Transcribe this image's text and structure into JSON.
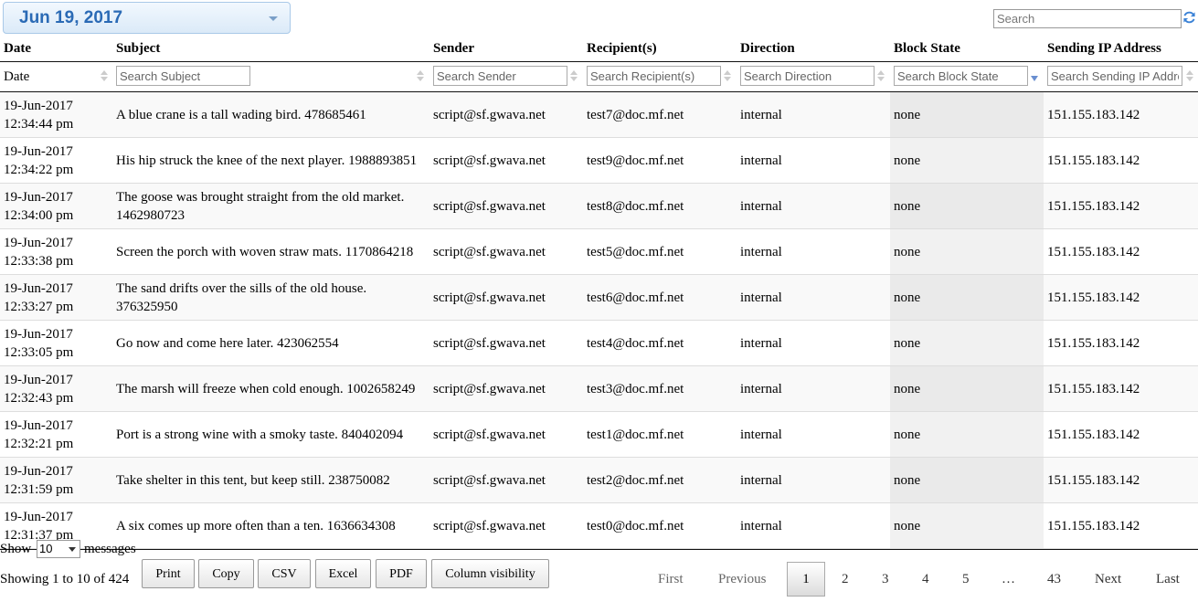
{
  "header": {
    "date_label": "Jun 19, 2017",
    "search_placeholder": "Search"
  },
  "table": {
    "columns": [
      "Date",
      "Subject",
      "Sender",
      "Recipient(s)",
      "Direction",
      "Block State",
      "Sending IP Address"
    ],
    "date_filter_label": "Date",
    "filter_placeholders": {
      "subject": "Search Subject",
      "sender": "Search Sender",
      "recipients": "Search Recipient(s)",
      "direction": "Search Direction",
      "block_state": "Search Block State",
      "ip": "Search Sending IP Address"
    },
    "rows": [
      {
        "date": "19-Jun-2017",
        "time": "12:34:44 pm",
        "subject": "A blue crane is a tall wading bird. 478685461",
        "sender": "script@sf.gwava.net",
        "recipient": "test7@doc.mf.net",
        "direction": "internal",
        "block_state": "none",
        "ip": "151.155.183.142"
      },
      {
        "date": "19-Jun-2017",
        "time": "12:34:22 pm",
        "subject": "His hip struck the knee of the next player. 1988893851",
        "sender": "script@sf.gwava.net",
        "recipient": "test9@doc.mf.net",
        "direction": "internal",
        "block_state": "none",
        "ip": "151.155.183.142"
      },
      {
        "date": "19-Jun-2017",
        "time": "12:34:00 pm",
        "subject": "The goose was brought straight from the old market. 1462980723",
        "sender": "script@sf.gwava.net",
        "recipient": "test8@doc.mf.net",
        "direction": "internal",
        "block_state": "none",
        "ip": "151.155.183.142"
      },
      {
        "date": "19-Jun-2017",
        "time": "12:33:38 pm",
        "subject": "Screen the porch with woven straw mats. 1170864218",
        "sender": "script@sf.gwava.net",
        "recipient": "test5@doc.mf.net",
        "direction": "internal",
        "block_state": "none",
        "ip": "151.155.183.142"
      },
      {
        "date": "19-Jun-2017",
        "time": "12:33:27 pm",
        "subject": "The sand drifts over the sills of the old house. 376325950",
        "sender": "script@sf.gwava.net",
        "recipient": "test6@doc.mf.net",
        "direction": "internal",
        "block_state": "none",
        "ip": "151.155.183.142"
      },
      {
        "date": "19-Jun-2017",
        "time": "12:33:05 pm",
        "subject": "Go now and come here later. 423062554",
        "sender": "script@sf.gwava.net",
        "recipient": "test4@doc.mf.net",
        "direction": "internal",
        "block_state": "none",
        "ip": "151.155.183.142"
      },
      {
        "date": "19-Jun-2017",
        "time": "12:32:43 pm",
        "subject": "The marsh will freeze when cold enough. 1002658249",
        "sender": "script@sf.gwava.net",
        "recipient": "test3@doc.mf.net",
        "direction": "internal",
        "block_state": "none",
        "ip": "151.155.183.142"
      },
      {
        "date": "19-Jun-2017",
        "time": "12:32:21 pm",
        "subject": "Port is a strong wine with a smoky taste. 840402094",
        "sender": "script@sf.gwava.net",
        "recipient": "test1@doc.mf.net",
        "direction": "internal",
        "block_state": "none",
        "ip": "151.155.183.142"
      },
      {
        "date": "19-Jun-2017",
        "time": "12:31:59 pm",
        "subject": "Take shelter in this tent, but keep still. 238750082",
        "sender": "script@sf.gwava.net",
        "recipient": "test2@doc.mf.net",
        "direction": "internal",
        "block_state": "none",
        "ip": "151.155.183.142"
      },
      {
        "date": "19-Jun-2017",
        "time": "12:31:37 pm",
        "subject": "A six comes up more often than a ten. 1636634308",
        "sender": "script@sf.gwava.net",
        "recipient": "test0@doc.mf.net",
        "direction": "internal",
        "block_state": "none",
        "ip": "151.155.183.142"
      }
    ]
  },
  "footer": {
    "show_label": "Show",
    "page_length": "10",
    "messages_label": "messages",
    "info": "Showing 1 to 10 of 424",
    "buttons": [
      "Print",
      "Copy",
      "CSV",
      "Excel",
      "PDF",
      "Column visibility"
    ],
    "pagination": {
      "first": "First",
      "previous": "Previous",
      "pages": [
        "1",
        "2",
        "3",
        "4",
        "5"
      ],
      "ellipsis": "…",
      "last_page": "43",
      "next": "Next",
      "last": "Last",
      "current": "1"
    }
  },
  "colors": {
    "accent": "#2a6ab5",
    "sort_active": "#6a8fd0"
  }
}
